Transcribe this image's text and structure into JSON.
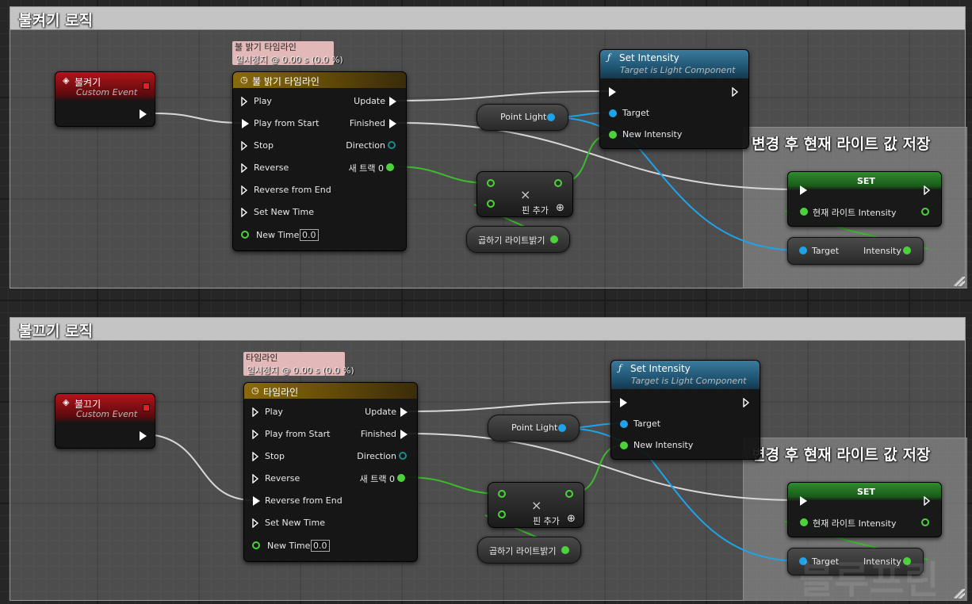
{
  "top": {
    "comment_title": "불켜기 로직",
    "event": {
      "title": "불켜기",
      "subtitle": "Custom Event"
    },
    "timeline_tooltip": {
      "line1": "불 밝기 타임라인",
      "line2": "일시정지 @ 0.00 s (0.0 %)"
    },
    "timeline": {
      "title": "불 밝기 타임라인"
    },
    "set_intensity": {
      "title": "Set Intensity",
      "subtitle": "Target is Light Component",
      "target": "Target",
      "new_intensity": "New Intensity"
    },
    "point_light": "Point Light",
    "multiply": {
      "symbol": "×",
      "add_pin": "핀 추가"
    },
    "brightness_var": "곱하기 라이트밝기",
    "save_comment": "변경 후 현재 라이트 값 저장",
    "set_node": {
      "title": "SET",
      "var": "현재 라이트 Intensity"
    },
    "intensity_getter": {
      "target": "Target",
      "output": "Intensity"
    }
  },
  "bottom": {
    "comment_title": "불끄기 로직",
    "event": {
      "title": "불끄기",
      "subtitle": "Custom Event"
    },
    "timeline_tooltip": {
      "line1": "타임라인",
      "line2": "일시정지 @ 0.00 s (0.0 %)"
    },
    "timeline": {
      "title": "타임라인"
    },
    "set_intensity": {
      "title": "Set Intensity",
      "subtitle": "Target is Light Component",
      "target": "Target",
      "new_intensity": "New Intensity"
    },
    "point_light": "Point Light",
    "multiply": {
      "symbol": "×",
      "add_pin": "핀 추가"
    },
    "brightness_var": "곱하기 라이트밝기",
    "save_comment": "변경 후 현재 라이트 값 저장",
    "set_node": {
      "title": "SET",
      "var": "현재 라이트 Intensity"
    },
    "intensity_getter": {
      "target": "Target",
      "output": "Intensity"
    }
  },
  "timeline_pins": {
    "inputs": [
      "Play",
      "Play from Start",
      "Stop",
      "Reverse",
      "Reverse from End",
      "Set New Time",
      "New Time"
    ],
    "outputs": [
      "Update",
      "Finished",
      "Direction",
      "새 트랙 0"
    ],
    "new_time_value": "0.0"
  },
  "watermark": "블루프린",
  "colors": {
    "exec": "#ffffff",
    "float_pin": "#4cd23a",
    "object_pin": "#1fa3e8",
    "event_header": "#b0141a",
    "timeline_header": "#8a6a0c",
    "function_header": "#3b7a9c",
    "set_header": "#2e8c2e"
  }
}
